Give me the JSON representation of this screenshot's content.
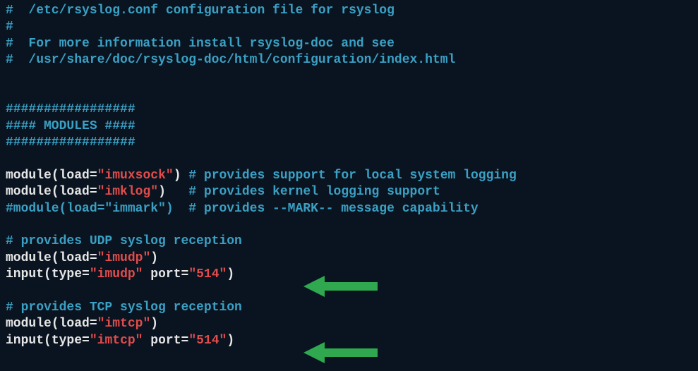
{
  "header": {
    "l1": "#  /etc/rsyslog.conf configuration file for rsyslog",
    "l2": "#",
    "l3": "#  For more information install rsyslog-doc and see",
    "l4": "#  /usr/share/doc/rsyslog-doc/html/configuration/index.html"
  },
  "modules_header": {
    "l1": "#################",
    "l2": "#### MODULES ####",
    "l3": "#################"
  },
  "module1": {
    "fn": "module",
    "attr": "load",
    "val": "\"imuxsock\"",
    "comment": " # provides support for local system logging"
  },
  "module2": {
    "fn": "module",
    "attr": "load",
    "val": "\"imklog\"",
    "pad": "   ",
    "comment": "# provides kernel logging support"
  },
  "module3": {
    "comment": "#module(load=\"immark\")  # provides --MARK-- message capability"
  },
  "udp": {
    "header": "# provides UDP syslog reception",
    "mod_fn": "module",
    "mod_attr": "load",
    "mod_val": "\"imudp\"",
    "in_fn": "input",
    "in_attr1": "type",
    "in_val1": "\"imudp\"",
    "in_attr2": "port",
    "in_val2": "\"514\""
  },
  "tcp": {
    "header": "# provides TCP syslog reception",
    "mod_fn": "module",
    "mod_attr": "load",
    "mod_val": "\"imtcp\"",
    "in_fn": "input",
    "in_attr1": "type",
    "in_val1": "\"imtcp\"",
    "in_attr2": "port",
    "in_val2": "\"514\""
  },
  "arrow_color": "#2fa84f"
}
